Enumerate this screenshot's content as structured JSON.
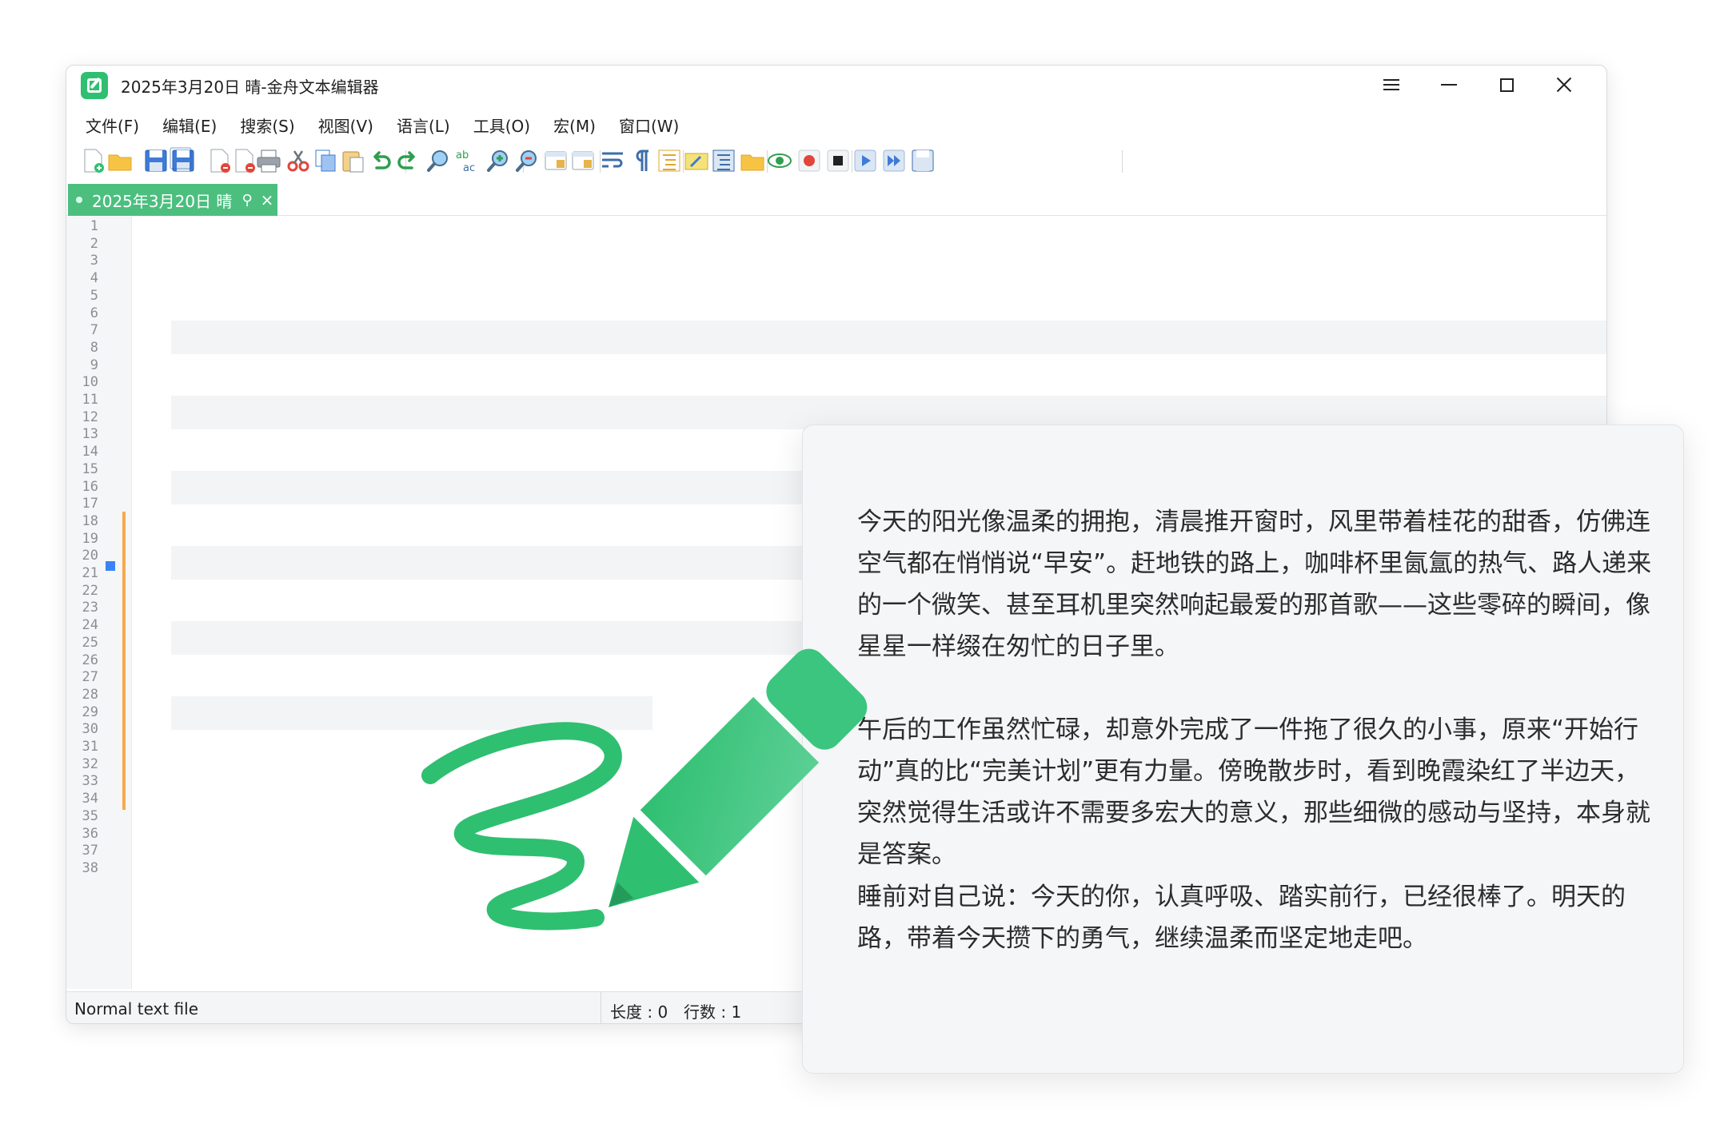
{
  "window": {
    "title": "2025年3月20日 晴-金舟文本编辑器",
    "accent_color": "#2fbf71"
  },
  "menu": [
    {
      "label": "文件(F)"
    },
    {
      "label": "编辑(E)"
    },
    {
      "label": "搜索(S)"
    },
    {
      "label": "视图(V)"
    },
    {
      "label": "语言(L)"
    },
    {
      "label": "工具(O)"
    },
    {
      "label": "宏(M)"
    },
    {
      "label": "窗口(W)"
    }
  ],
  "toolbar": [
    {
      "name": "new-file-icon"
    },
    {
      "name": "open-folder-icon"
    },
    {
      "name": "save-icon"
    },
    {
      "name": "save-all-icon"
    },
    {
      "name": "close-file-icon"
    },
    {
      "name": "close-all-icon"
    },
    {
      "name": "print-icon"
    },
    {
      "name": "cut-icon"
    },
    {
      "name": "copy-icon"
    },
    {
      "name": "paste-icon"
    },
    {
      "name": "undo-icon"
    },
    {
      "name": "redo-icon"
    },
    {
      "name": "find-icon"
    },
    {
      "name": "replace-icon"
    },
    {
      "name": "zoom-in-icon"
    },
    {
      "name": "zoom-out-icon"
    },
    {
      "name": "sync-vertical-icon"
    },
    {
      "name": "sync-horizontal-icon"
    },
    {
      "name": "word-wrap-icon"
    },
    {
      "name": "show-all-chars-icon"
    },
    {
      "name": "indent-guide-icon"
    },
    {
      "name": "language-define-icon"
    },
    {
      "name": "document-map-icon"
    },
    {
      "name": "folder-workspace-icon"
    },
    {
      "name": "monitoring-eye-icon"
    },
    {
      "name": "macro-record-icon"
    },
    {
      "name": "macro-stop-icon"
    },
    {
      "name": "macro-play-icon"
    },
    {
      "name": "macro-run-multiple-icon"
    },
    {
      "name": "macro-save-icon"
    }
  ],
  "tab": {
    "label": "2025年3月20日 晴",
    "pin_glyph": "⚲",
    "close_glyph": "×"
  },
  "gutter": {
    "line_numbers": [
      "1",
      "2",
      "3",
      "4",
      "5",
      "6",
      "7",
      "8",
      "9",
      "10",
      "11",
      "12",
      "13",
      "14",
      "15",
      "16",
      "17",
      "18",
      "19",
      "20",
      "21",
      "22",
      "23",
      "24",
      "25",
      "26",
      "27",
      "28",
      "29",
      "30",
      "31",
      "32",
      "33",
      "34",
      "35",
      "36",
      "37",
      "38"
    ],
    "change_color": "#f6a94d",
    "bookmark_color": "#3b82f6"
  },
  "statusbar": {
    "file_type": "Normal text file",
    "length": "长度 : 0",
    "lines": "行数 : 1"
  },
  "note": {
    "paragraphs": [
      "今天的阳光像温柔的拥抱，清晨推开窗时，风里带着桂花的甜香，仿佛连空气都在悄悄说“早安”。赶地铁的路上，咖啡杯里氤氲的热气、路人递来的一个微笑、甚至耳机里突然响起最爱的那首歌——这些零碎的瞬间，像星星一样缀在匆忙的日子里。",
      "午后的工作虽然忙碌，却意外完成了一件拖了很久的小事，原来“开始行动”真的比“完美计划”更有力量。傍晚散步时，看到晚霞染红了半边天，突然觉得生活或许不需要多宏大的意义，那些细微的感动与坚持，本身就是答案。",
      "睡前对自己说：今天的你，认真呼吸、踏实前行，已经很棒了。明天的路，带着今天攒下的勇气，继续温柔而坚定地走吧。"
    ]
  },
  "illustration": {
    "icon": "pen-signature-icon",
    "color": "#2fbf71"
  }
}
